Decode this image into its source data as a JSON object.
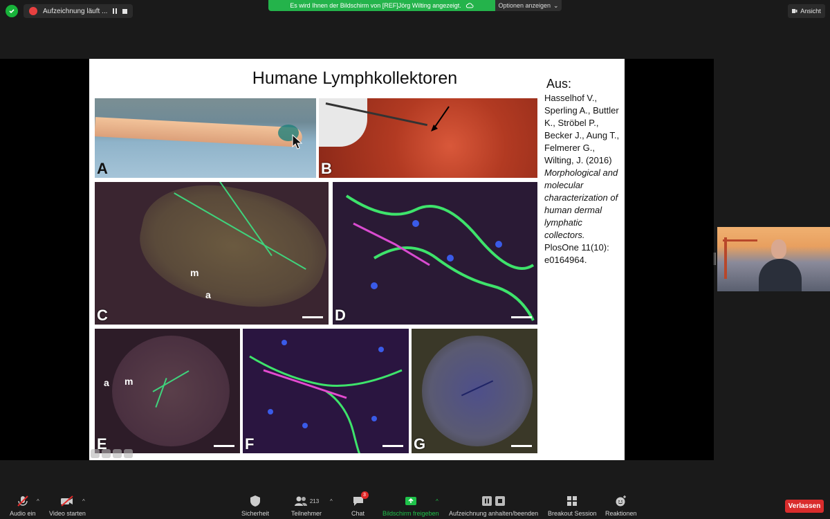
{
  "top": {
    "recording_label": "Aufzeichnung läuft ...",
    "share_message": "Es wird Ihnen der Bildschirm von [REF]Jörg Wilting angezeigt.",
    "options_label": "Optionen anzeigen",
    "view_label": "Ansicht"
  },
  "slide": {
    "title": "Humane Lymphkollektoren",
    "ref_heading": "Aus:",
    "ref_authors": "Hasselhof V., Sperling A., Buttler K., Ströbel P., Becker J., Aung T., Felmerer G., Wilting, J. (2016)",
    "ref_title": "Morphological and molecular characterization of human dermal lymphatic collectors.",
    "ref_journal": "PlosOne 11(10): e0164964.",
    "panels": {
      "a": "A",
      "b": "B",
      "c": "C",
      "d": "D",
      "e": "E",
      "f": "F",
      "g": "G",
      "c_m": "m",
      "c_a": "a",
      "e_a": "a",
      "e_m": "m"
    }
  },
  "toolbar": {
    "audio": "Audio ein",
    "video": "Video starten",
    "security": "Sicherheit",
    "participants": "Teilnehmer",
    "participant_count": "213",
    "chat": "Chat",
    "chat_badge": "3",
    "share": "Bildschirm freigeben",
    "recording": "Aufzeichnung anhalten/beenden",
    "breakout": "Breakout Session",
    "reactions": "Reaktionen",
    "leave": "Verlassen"
  },
  "colors": {
    "share_green": "#24b34b",
    "leave_red": "#d92c2c",
    "share_active": "#1fc24a"
  }
}
